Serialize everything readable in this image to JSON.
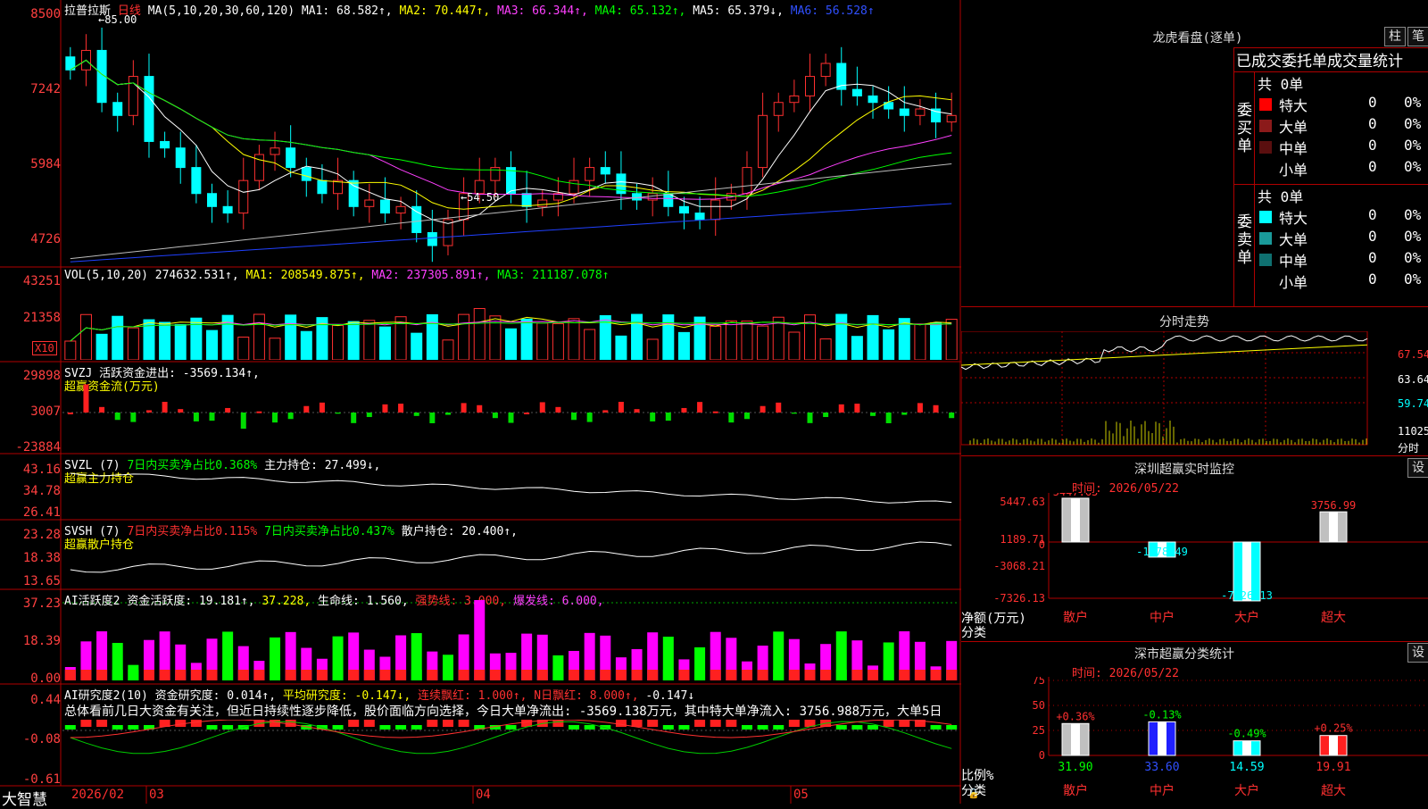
{
  "stock": {
    "name": "拉普拉斯",
    "period": "日线",
    "ma_params": "MA(5,10,20,30,60,120)",
    "ma1": "MA1: 68.582↑,",
    "ma2": "MA2: 70.447↑,",
    "ma3": "MA3: 66.344↑,",
    "ma4": "MA4: 65.132↑,",
    "ma5": "MA5: 65.379↓,",
    "ma6": "MA6: 56.528↑"
  },
  "price_axis": [
    "8500",
    "7242",
    "5984",
    "4726"
  ],
  "annotations": {
    "high": "85.00",
    "low": "54.50"
  },
  "vol": {
    "title": "VOL(5,10,20)",
    "val": "274632.531↑,",
    "ma1": "MA1: 208549.875↑,",
    "ma2": "MA2: 237305.891↑,",
    "ma3": "MA3: 211187.078↑",
    "axis": [
      "43251",
      "21358"
    ],
    "unit": "X10"
  },
  "svzj": {
    "title": "SVZJ",
    "line": "活跃资金进出: -3569.134↑,",
    "sub": "超赢资金流(万元)",
    "axis": [
      "29898",
      "3007",
      "-23884"
    ]
  },
  "svzl": {
    "title": "SVZL (7)",
    "a": "7日内买卖净占比0.368%",
    "b": "主力持仓: 27.499↓,",
    "sub": "超赢主力持仓",
    "axis": [
      "43.16",
      "34.78",
      "26.41"
    ]
  },
  "svsh": {
    "title": "SVSH (7)",
    "a": "7日内买卖净占比0.115%",
    "b": "7日内买卖净占比0.437%",
    "c": "散户持仓: 20.400↑,",
    "sub": "超赢散户持仓",
    "axis": [
      "23.28",
      "18.38",
      "13.65"
    ]
  },
  "ai2": {
    "title": "AI活跃度2",
    "a": "资金活跃度: 19.181↑,",
    "b": "37.228,",
    "c": "生命线: 1.560,",
    "d": "强势线: 3.000,",
    "e": "爆发线: 6.000,",
    "axis": [
      "37.23",
      "18.39",
      "0.00"
    ]
  },
  "ai_r": {
    "title": "AI研究度2(10)",
    "a": "资金研究度: 0.014↑,",
    "b": "平均研究度: -0.147↓,",
    "c": "连续飘红: 1.000↑,",
    "d": "N日飘红: 8.000↑,",
    "e": "-0.147↓",
    "text": "总体看前几日大资金有关注，但近日持续性逐步降低，股价面临方向选择，今日大单净流出: -3569.138万元，其中特大单净流入: 3756.988万元，大单5日",
    "axis": [
      "0.44",
      "-0.08",
      "-0.61"
    ]
  },
  "footer": {
    "brand": "大智慧",
    "dates": [
      "2026/02",
      "03",
      "04",
      "05"
    ]
  },
  "lhb": {
    "title": "龙虎看盘(逐单)",
    "btn1": "柱",
    "btn2": "笔",
    "cols": "已成交委托单成交量统计",
    "buy": {
      "label": "委买单",
      "total": "共 0单",
      "rows": [
        {
          "name": "特大",
          "n": "0",
          "p": "0%",
          "color": "#ff0000"
        },
        {
          "name": "大单",
          "n": "0",
          "p": "0%",
          "color": "#8b1a1a"
        },
        {
          "name": "中单",
          "n": "0",
          "p": "0%",
          "color": "#5a0f0f"
        },
        {
          "name": "小单",
          "n": "0",
          "p": "0%",
          "color": "#000000"
        }
      ]
    },
    "sell": {
      "label": "委卖单",
      "total": "共 0单",
      "rows": [
        {
          "name": "特大",
          "n": "0",
          "p": "0%",
          "color": "#00ffff"
        },
        {
          "name": "大单",
          "n": "0",
          "p": "0%",
          "color": "#1a9a9a"
        },
        {
          "name": "中单",
          "n": "0",
          "p": "0%",
          "color": "#0f7070"
        },
        {
          "name": "小单",
          "n": "0",
          "p": "0%",
          "color": "#000000"
        }
      ]
    }
  },
  "fenshi": {
    "title": "分时走势",
    "axis": [
      "67.54",
      "63.64",
      "59.74"
    ],
    "vol": "11025",
    "vol2": "分时"
  },
  "monitor": {
    "title": "深圳超赢实时监控",
    "set": "设",
    "time": "时间: 2026/05/22",
    "axis": [
      "5447.63",
      "1189.71",
      "0",
      "-3068.21",
      "-7326.13"
    ],
    "ylabel": "净额(万元)",
    "xlabel": "分类",
    "cats": [
      "散户",
      "中户",
      "大户",
      "超大"
    ],
    "values": [
      "5447.63",
      "-1878.49",
      "-7326.13",
      "3756.99"
    ]
  },
  "classify": {
    "title": "深市超赢分类统计",
    "set": "设",
    "time": "时间: 2026/05/22",
    "axis": [
      "75",
      "50",
      "25",
      "0"
    ],
    "ylabel": "比例%",
    "xlabel": "分类",
    "cats": [
      "散户",
      "中户",
      "大户",
      "超大"
    ],
    "pct": [
      "+0.36%",
      "-0.13%",
      "-0.49%",
      "+0.25%"
    ],
    "vals": [
      "31.90",
      "33.60",
      "14.59",
      "19.91"
    ]
  },
  "chart_data": [
    {
      "type": "candlestick",
      "title": "拉普拉斯 日线",
      "ylim": [
        47.26,
        85.0
      ],
      "close": [
        77,
        80,
        72,
        70,
        76,
        66,
        65,
        62,
        58,
        56,
        55,
        60,
        64,
        65,
        62,
        60,
        58,
        60,
        56,
        57,
        55,
        56,
        52,
        50,
        54,
        58,
        60,
        62,
        58,
        56,
        57,
        58,
        60,
        62,
        61,
        58,
        57,
        58,
        56,
        55,
        54,
        57,
        58,
        62,
        70,
        72,
        73,
        76,
        78,
        74,
        73,
        72,
        71,
        70,
        71,
        69,
        70
      ]
    }
  ]
}
